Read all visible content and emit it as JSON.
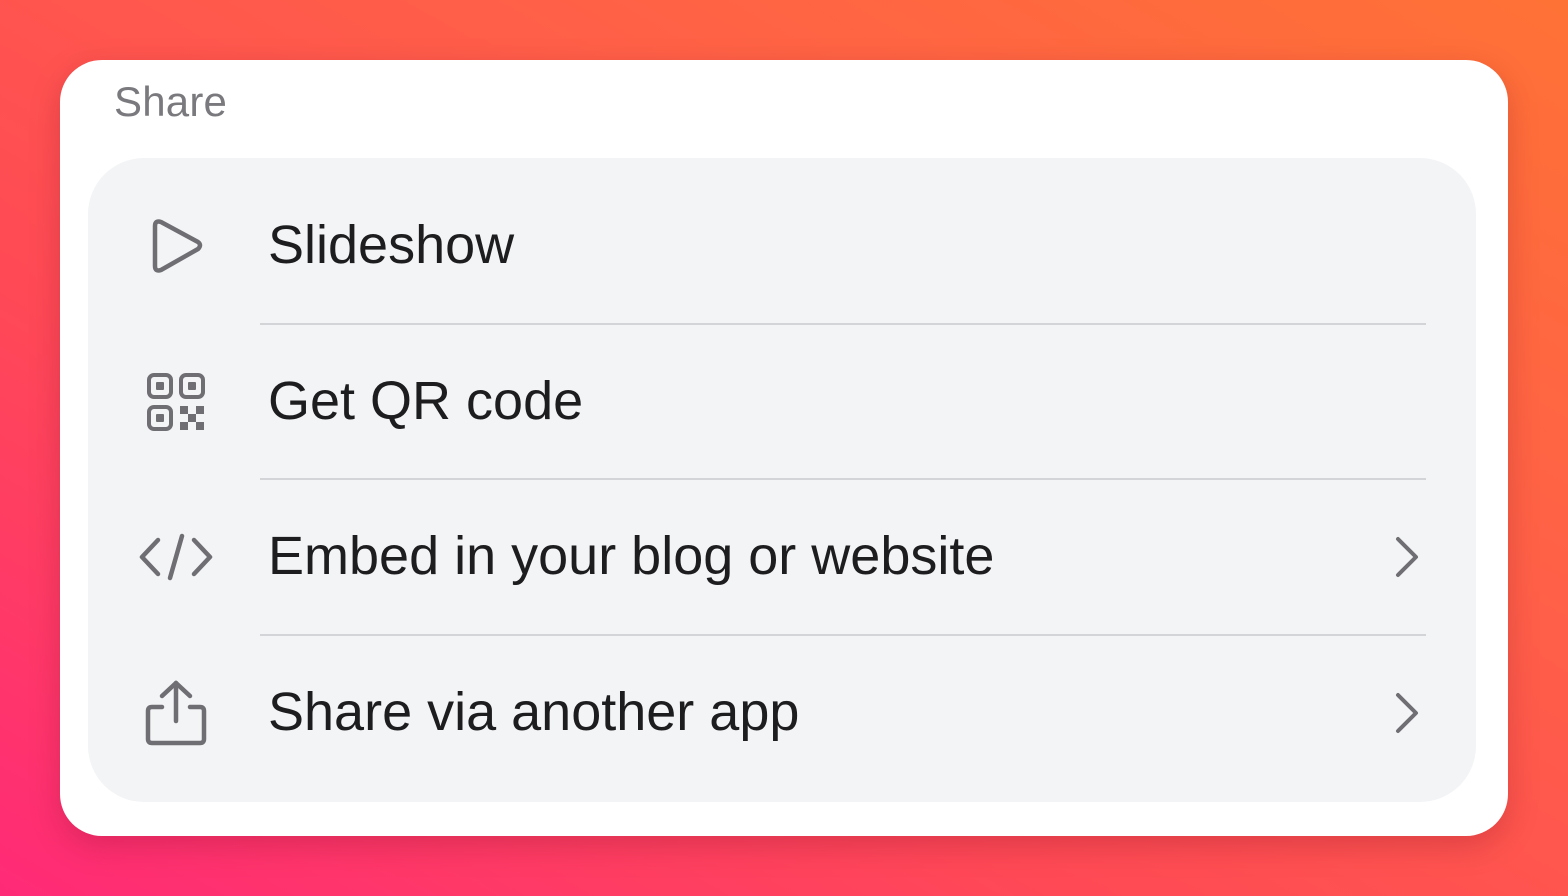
{
  "sheet": {
    "title": "Share",
    "items": [
      {
        "label": "Slideshow",
        "icon": "play-icon",
        "has_chevron": false
      },
      {
        "label": "Get QR code",
        "icon": "qr-code-icon",
        "has_chevron": false
      },
      {
        "label": "Embed in your blog or website",
        "icon": "code-icon",
        "has_chevron": true
      },
      {
        "label": "Share via another app",
        "icon": "share-icon",
        "has_chevron": true
      }
    ]
  },
  "colors": {
    "background_gradient": [
      "#ff2a77",
      "#ff7236"
    ],
    "card": "#ffffff",
    "menu_background": "#f3f4f6",
    "icon": "#6f6f73",
    "text": "#1d1d1f",
    "title_text": "#7a7a7e",
    "divider": "#d3d4d8"
  }
}
